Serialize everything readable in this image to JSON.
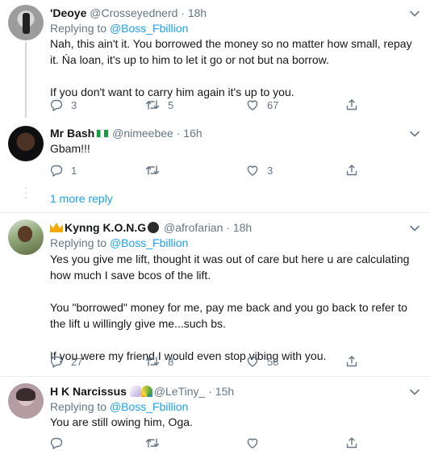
{
  "tweets": [
    {
      "name": "'Deoye",
      "handle": "@Crosseyednerd",
      "dot": "·",
      "time": "18h",
      "reply_prefix": "Replying to ",
      "reply_to": "@Boss_Fbillion",
      "paragraphs": [
        "Nah, this ain't it. You borrowed the money so no matter how small, repay it. Ńa loan, it's up to him to let it go or not but na borrow.",
        "If you don't want to carry him again it's up to you."
      ],
      "replies": "3",
      "retweets": "5",
      "likes": "67"
    },
    {
      "name": "Mr Bash",
      "handle": "@nimeebee",
      "dot": "·",
      "time": "16h",
      "paragraphs": [
        "Gbam!!!"
      ],
      "replies": "1",
      "retweets": "",
      "likes": "3"
    },
    {
      "name": "Kynng K.O.N.G",
      "handle": "@afrofarian",
      "dot": "·",
      "time": "18h",
      "reply_prefix": "Replying to ",
      "reply_to": "@Boss_Fbillion",
      "paragraphs": [
        "Yes you give me lift, thought it was out of care but here u are calculating how much I save bcos of the lift.",
        "You \"borrowed\" money for me, pay me back and you go back to refer to the lift u willingly give me...such bs.",
        "If you were my friend I would even stop vibing with you."
      ],
      "replies": "27",
      "retweets": "8",
      "likes": "58"
    },
    {
      "name": "H K Narcissus",
      "handle": "@LeTiny_",
      "dot": "·",
      "time": "15h",
      "reply_prefix": "Replying to ",
      "reply_to": "@Boss_Fbillion",
      "paragraphs": [
        "You are still owing him, Oga."
      ],
      "replies": "",
      "retweets": "",
      "likes": ""
    }
  ],
  "more_replies": "1 more reply",
  "colors": {
    "accent": "#1da1f2",
    "muted": "#657786",
    "text": "#14171a",
    "divider": "#e6ecf0"
  },
  "icons": [
    "reply-icon",
    "retweet-icon",
    "like-icon",
    "share-icon",
    "chevron-down-icon"
  ]
}
